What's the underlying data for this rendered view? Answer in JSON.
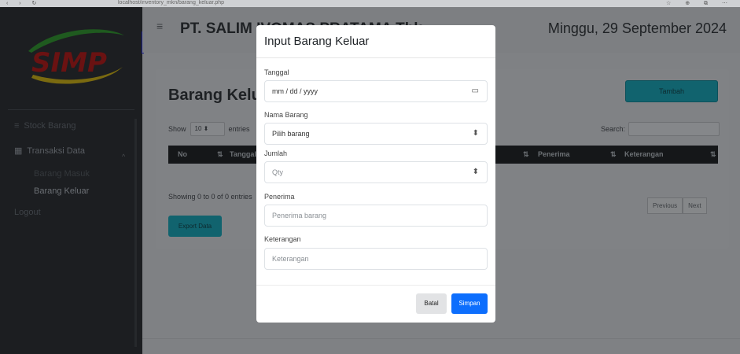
{
  "browser": {
    "url": "localhost/inventory_mkn/barang_keluar.php",
    "nav_icons": "‹ › ↻",
    "right_icons": "☆ ⊕ ⧉ ⋯"
  },
  "sidebar": {
    "logo_text": "SIMP",
    "items": [
      {
        "label": "Stock Barang",
        "icon": "stack-icon"
      },
      {
        "label": "Transaksi Data",
        "icon": "table-icon"
      },
      {
        "label": "Barang Masuk"
      },
      {
        "label": "Barang Keluar"
      },
      {
        "label": "Logout"
      }
    ],
    "chevron": "^"
  },
  "header": {
    "menu_icon": "≡",
    "company": "PT. SALIM IVOMAS PRATAMA Tbk",
    "date": "Minggu, 29 September 2024"
  },
  "page": {
    "title": "Barang Keluar",
    "add_button": "Tambah",
    "show_label": "Show",
    "entries_value": "10",
    "entries_label": "entries",
    "search_label": "Search:",
    "columns": [
      "No",
      "Tanggal",
      "Penerima",
      "Keterangan"
    ],
    "sort_icon": "⇅",
    "showing": "Showing 0 to 0 of 0 entries",
    "prev": "Previous",
    "next": "Next",
    "export_button": "Export Data"
  },
  "modal": {
    "title": "Input Barang Keluar",
    "fields": [
      {
        "label": "Tanggal",
        "value": "mm / dd / yyyy",
        "icon": "calendar-icon"
      },
      {
        "label": "Nama Barang",
        "value": "Pilih barang",
        "icon": "select-arrows-icon"
      },
      {
        "label": "Jumlah",
        "placeholder": "Qty",
        "icon": "spinner-icon"
      },
      {
        "label": "Penerima",
        "placeholder": "Penerima barang"
      },
      {
        "label": "Keterangan",
        "placeholder": "Keterangan"
      }
    ],
    "cancel": "Batal",
    "save": "Simpan"
  },
  "colors": {
    "primary": "#0d6efd",
    "teal": "#11636e",
    "sidebar": "#1c1e21",
    "overlay_bg": "#7f8184"
  }
}
